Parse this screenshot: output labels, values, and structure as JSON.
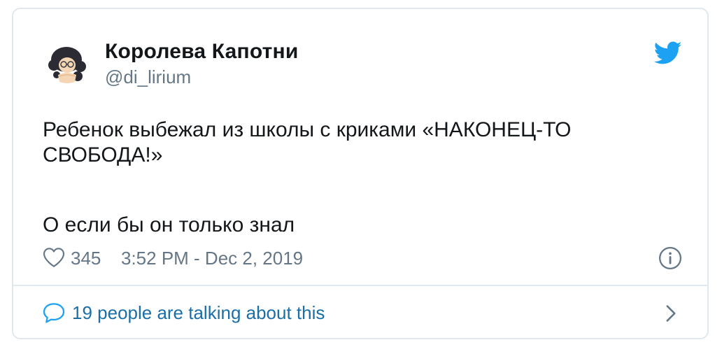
{
  "author": {
    "display_name": "Королева Капотни",
    "handle": "@di_lirium"
  },
  "tweet": {
    "paragraphs": [
      "Ребенок выбежал из школы с криками «НАКОНЕЦ-ТО СВОБОДА!»",
      "О если бы он только знал"
    ]
  },
  "footer": {
    "likes": "345",
    "timestamp": "3:52 PM - Dec 2, 2019"
  },
  "conversation": {
    "label": "19 people are talking about this"
  },
  "icons": {
    "brand": "twitter-bird-icon",
    "like": "heart-icon",
    "info": "info-icon",
    "reply": "speech-bubble-icon",
    "more": "chevron-right-icon"
  },
  "colors": {
    "twitter_blue": "#1da1f2",
    "link_blue": "#1b6fa8",
    "secondary_text": "#657786",
    "primary_text": "#14171a",
    "border": "#e1e8ed"
  }
}
